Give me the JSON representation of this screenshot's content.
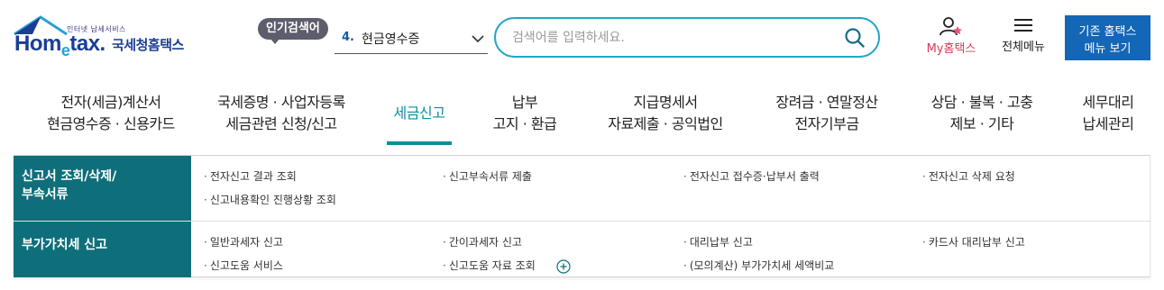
{
  "header": {
    "logo": {
      "small_text": "인터넷 납세서비스",
      "wordmark_ho": "Ho",
      "wordmark_m": "m",
      "wordmark_e": "e",
      "wordmark_tax": "tax.",
      "korean_name": "국세청홈택스"
    },
    "popular": {
      "label": "인기검색어",
      "rank": "4.",
      "term": "현금영수증"
    },
    "search": {
      "placeholder": "검색어를 입력하세요.",
      "value": ""
    },
    "my_hometax_label": "My홈택스",
    "all_menu_label": "전체메뉴",
    "classic_menu": {
      "line1": "기존 홈택스",
      "line2": "메뉴 보기"
    }
  },
  "nav": [
    {
      "line1": "전자(세금)계산서",
      "line2": "현금영수증 · 신용카드"
    },
    {
      "line1": "국세증명 · 사업자등록",
      "line2": "세금관련 신청/신고"
    },
    {
      "line1": "세금신고",
      "line2": ""
    },
    {
      "line1": "납부",
      "line2": "고지 · 환급"
    },
    {
      "line1": "지급명세서",
      "line2": "자료제출 · 공익법인"
    },
    {
      "line1": "장려금 · 연말정산",
      "line2": "전자기부금"
    },
    {
      "line1": "상담 · 불복 · 고충",
      "line2": "제보 · 기타"
    },
    {
      "line1": "세무대리",
      "line2": "납세관리"
    }
  ],
  "submenu": [
    {
      "heading_line1": "신고서 조회/삭제/",
      "heading_line2": "부속서류",
      "links": [
        "전자신고 결과 조회",
        "신고부속서류 제출",
        "전자신고 접수증·납부서 출력",
        "전자신고 삭제 요청",
        "신고내용확인 진행상황 조회"
      ]
    },
    {
      "heading_line1": "부가가치세 신고",
      "heading_line2": "",
      "links": [
        "일반과세자 신고",
        "간이과세자 신고",
        "대리납부 신고",
        "카드사 대리납부 신고",
        "신고도움 서비스",
        "신고도움 자료 조회",
        "(모의계산) 부가가치세 세액비교"
      ]
    }
  ],
  "colors": {
    "brand_navy": "#1a3e96",
    "teal_accent": "#0b8f9b",
    "section_header": "#0e6f7a",
    "search_border": "#24a6c6",
    "classic_button": "#1466b6",
    "my_hometax_pink": "#d43a5c"
  },
  "icons": [
    "house-logo-icon",
    "chevron-down-icon",
    "search-icon",
    "user-star-icon",
    "hamburger-menu-icon",
    "plus-circle-icon"
  ]
}
